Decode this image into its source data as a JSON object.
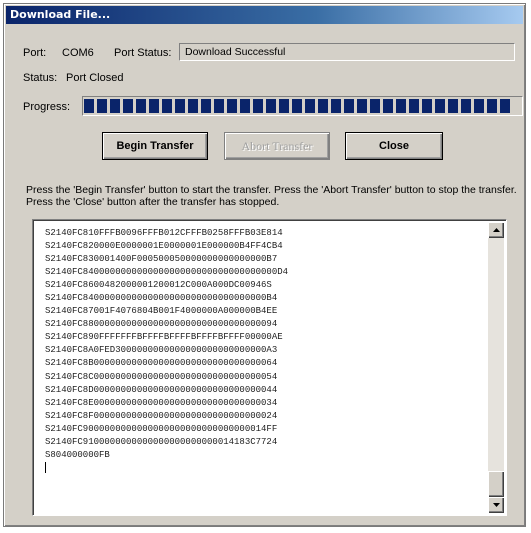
{
  "window": {
    "title": "Download File..."
  },
  "port": {
    "label": "Port:",
    "value": "COM6",
    "status_label": "Port Status:",
    "status_value": "Download Successful"
  },
  "status": {
    "label": "Status:",
    "value": "Port Closed"
  },
  "progress": {
    "label": "Progress:",
    "fraction": 1.0,
    "color": "#0a246a"
  },
  "buttons": {
    "begin": "Begin Transfer",
    "abort": "Abort Transfer",
    "close": "Close"
  },
  "instructions": "Press the 'Begin Transfer' button to start the transfer.  Press the 'Abort Transfer' button to stop the transfer.  Press the 'Close' button after the transfer has stopped.",
  "log_lines": [
    "S2140FC810FFFB0096FFFB012CFFFB0258FFFB03E814",
    "S2140FC820000E0000001E0000001E000000B4FF4CB4",
    "S2140FC830001400F000500050000000000000000B7",
    "S2140FC840000000000000000000000000000000000D4",
    "S2140FC8600482000001200012C000A000DC00946S",
    "S2140FC8400000000000000000000000000000000B4",
    "S2140FC87001F4076804B001F4000000A000000B4EE",
    "S2140FC880000000000000000000000000000000094",
    "S2140FC890FFFFFFFBFFFFBFFFFBFFFFBFFFF00000AE",
    "S2140FC8A0FED3000000000000000000000000000A3",
    "S2140FC8B0000000000000000000000000000000064",
    "S2140FC8C0000000000000000000000000000000054",
    "S2140FC8D0000000000000000000000000000000044",
    "S2140FC8E0000000000000000000000000000000034",
    "S2140FC8F0000000000000000000000000000000024",
    "S2140FC9000000000000000000000000000000014FF",
    "S2140FC9100000000000000000000000014183C7724",
    "S804000000FB"
  ]
}
